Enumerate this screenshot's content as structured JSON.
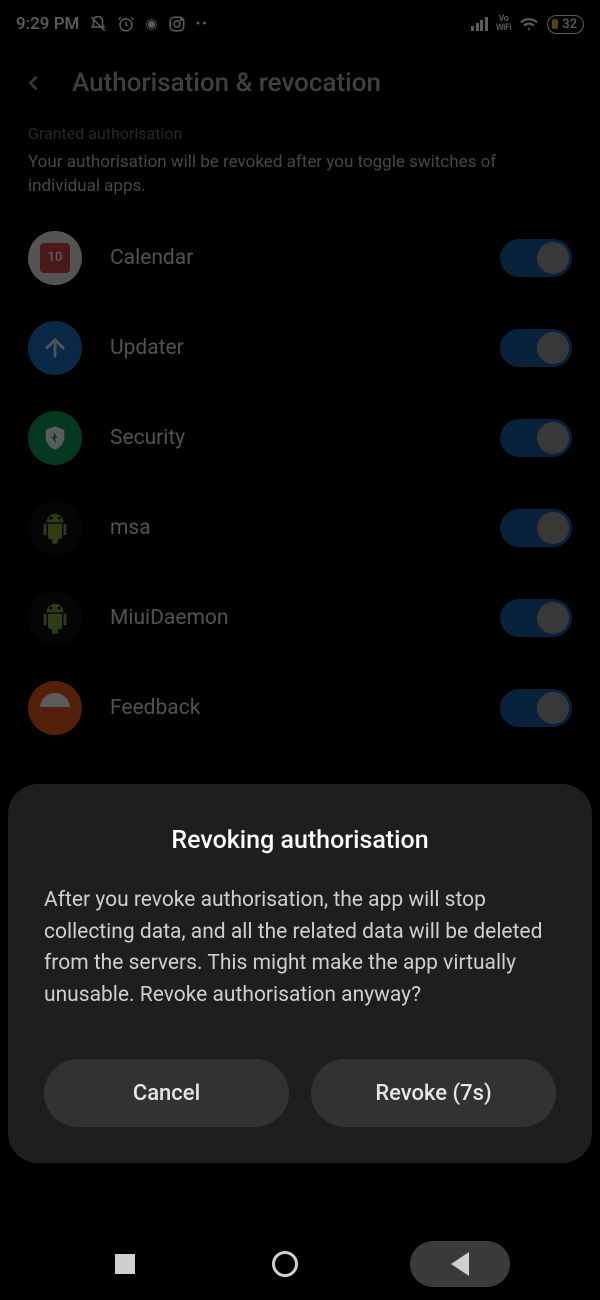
{
  "status": {
    "time": "9:29 PM",
    "battery": "32",
    "vowifi_top": "Vo",
    "vowifi_bottom": "WiFi"
  },
  "header": {
    "title": "Authorisation & revocation"
  },
  "section": {
    "subhead": "Granted authorisation",
    "description": "Your authorisation will be revoked after you toggle switches of individual apps."
  },
  "apps": [
    {
      "name": "Calendar",
      "icon": "calendar",
      "badge": "10",
      "enabled": true
    },
    {
      "name": "Updater",
      "icon": "updater",
      "enabled": true
    },
    {
      "name": "Security",
      "icon": "security",
      "enabled": true
    },
    {
      "name": "msa",
      "icon": "android",
      "enabled": true
    },
    {
      "name": "MiuiDaemon",
      "icon": "android",
      "enabled": true
    },
    {
      "name": "Feedback",
      "icon": "feedback",
      "enabled": true
    }
  ],
  "dialog": {
    "title": "Revoking authorisation",
    "body": "After you revoke authorisation, the app will stop collecting data, and all the related data will be deleted from the servers. This might make the app virtually unusable. Revoke authorisation anyway?",
    "cancel": "Cancel",
    "confirm": "Revoke (7s)"
  }
}
